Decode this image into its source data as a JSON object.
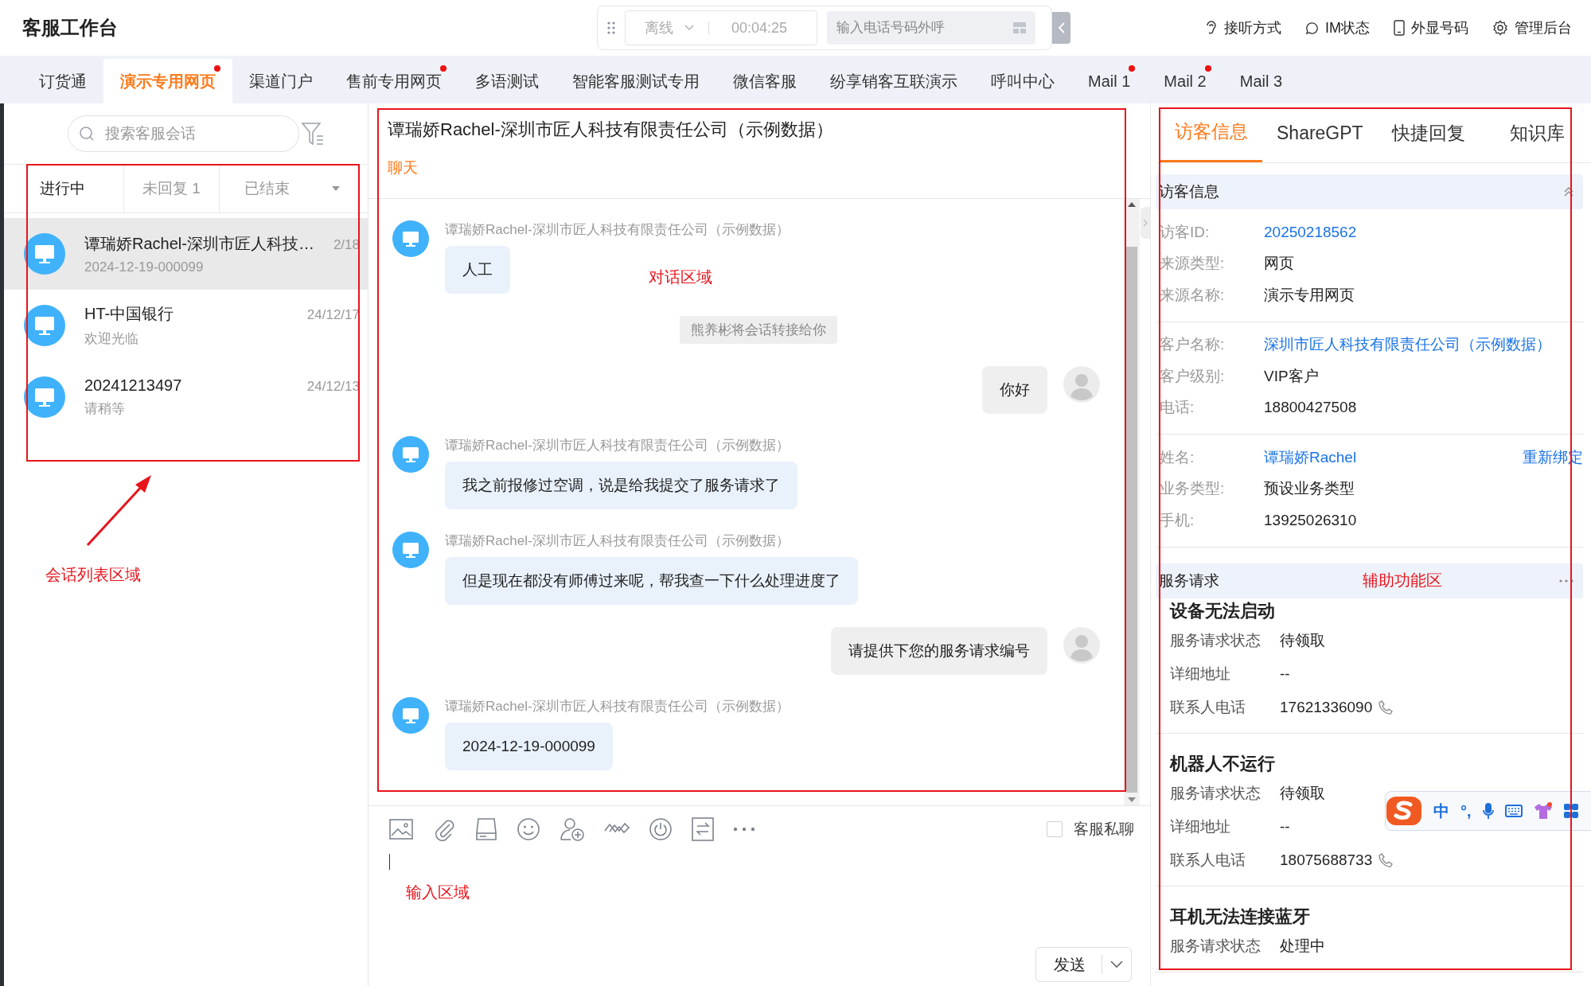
{
  "header": {
    "title": "客服工作台",
    "status": "离线",
    "timer": "00:04:25",
    "dial_placeholder": "输入电话号码外呼",
    "actions": [
      {
        "kind": "ear",
        "label": "接听方式"
      },
      {
        "kind": "chat",
        "label": "IM状态"
      },
      {
        "kind": "phone",
        "label": "外显号码"
      },
      {
        "kind": "gear",
        "label": "管理后台"
      }
    ]
  },
  "tabs": [
    {
      "label": "订货通",
      "selected": false,
      "unread": false
    },
    {
      "label": "演示专用网页",
      "selected": true,
      "unread": true
    },
    {
      "label": "渠道门户",
      "selected": false,
      "unread": false
    },
    {
      "label": "售前专用网页",
      "selected": false,
      "unread": true
    },
    {
      "label": "多语测试",
      "selected": false,
      "unread": false
    },
    {
      "label": "智能客服测试专用",
      "selected": false,
      "unread": false
    },
    {
      "label": "微信客服",
      "selected": false,
      "unread": false
    },
    {
      "label": "纷享销客互联演示",
      "selected": false,
      "unread": false
    },
    {
      "label": "呼叫中心",
      "selected": false,
      "unread": false
    },
    {
      "label": "Mail 1",
      "selected": false,
      "unread": true
    },
    {
      "label": "Mail 2",
      "selected": false,
      "unread": true
    },
    {
      "label": "Mail 3",
      "selected": false,
      "unread": false
    }
  ],
  "sessions": {
    "search_placeholder": "搜索客服会话",
    "filters": [
      {
        "label": "进行中",
        "selected": true
      },
      {
        "label": "未回复 1",
        "selected": false
      },
      {
        "label": "已结束",
        "selected": false
      }
    ],
    "items": [
      {
        "name": "谭瑞娇Rachel-深圳市匠人科技…",
        "time": "2/18",
        "preview": "2024-12-19-000099",
        "selected": true
      },
      {
        "name": "HT-中国银行",
        "time": "24/12/17",
        "preview": "欢迎光临",
        "selected": false
      },
      {
        "name": "20241213497",
        "time": "24/12/13",
        "preview": "请稍等",
        "selected": false
      }
    ]
  },
  "chat": {
    "title": "谭瑞娇Rachel-深圳市匠人科技有限责任公司（示例数据）",
    "tab": "聊天",
    "messages": [
      {
        "kind": "incoming",
        "sender": "谭瑞娇Rachel-深圳市匠人科技有限责任公司（示例数据）",
        "text": "人工"
      },
      {
        "kind": "system",
        "text": "熊养彬将会话转接给你"
      },
      {
        "kind": "outgoing",
        "text": "你好"
      },
      {
        "kind": "incoming",
        "sender": "谭瑞娇Rachel-深圳市匠人科技有限责任公司（示例数据）",
        "text": "我之前报修过空调，说是给我提交了服务请求了"
      },
      {
        "kind": "incoming",
        "sender": "谭瑞娇Rachel-深圳市匠人科技有限责任公司（示例数据）",
        "text": "但是现在都没有师傅过来呢，帮我查一下什么处理进度了"
      },
      {
        "kind": "outgoing",
        "text": "请提供下您的服务请求编号"
      },
      {
        "kind": "incoming",
        "sender": "谭瑞娇Rachel-深圳市匠人科技有限责任公司（示例数据）",
        "text": "2024-12-19-000099"
      }
    ],
    "private_chat": {
      "label": "客服私聊",
      "checked": false
    },
    "send": "发送"
  },
  "side": {
    "tabs": [
      {
        "label": "访客信息",
        "selected": true
      },
      {
        "label": "ShareGPT",
        "selected": false
      },
      {
        "label": "快捷回复",
        "selected": false
      },
      {
        "label": "知识库",
        "selected": false
      }
    ],
    "visitor": {
      "title": "访客信息",
      "groups": [
        [
          {
            "label": "访客ID:",
            "value": "20250218562",
            "link": true
          },
          {
            "label": "来源类型:",
            "value": "网页",
            "link": false
          },
          {
            "label": "来源名称:",
            "value": "演示专用网页",
            "link": false
          }
        ],
        [
          {
            "label": "客户名称:",
            "value": "深圳市匠人科技有限责任公司（示例数据）",
            "link": true
          },
          {
            "label": "客户级别:",
            "value": "VIP客户",
            "link": false
          },
          {
            "label": "电话:",
            "value": "18800427508",
            "link": false
          }
        ],
        [
          {
            "label": "姓名:",
            "value": "谭瑞娇Rachel",
            "link": true,
            "action": "重新绑定"
          },
          {
            "label": "业务类型:",
            "value": "预设业务类型",
            "link": false
          },
          {
            "label": "手机:",
            "value": "13925026310",
            "link": false
          }
        ]
      ]
    },
    "service": {
      "title": "服务请求",
      "requests": [
        {
          "title": "设备无法启动",
          "fields": [
            {
              "label": "服务请求状态",
              "value": "待领取",
              "phone": false
            },
            {
              "label": "详细地址",
              "value": "--",
              "phone": false
            },
            {
              "label": "联系人电话",
              "value": "17621336090",
              "phone": true
            }
          ]
        },
        {
          "title": "机器人不运行",
          "fields": [
            {
              "label": "服务请求状态",
              "value": "待领取",
              "phone": false
            },
            {
              "label": "详细地址",
              "value": "--",
              "phone": false
            },
            {
              "label": "联系人电话",
              "value": "18075688733",
              "phone": true
            }
          ]
        },
        {
          "title": "耳机无法连接蓝牙",
          "fields": [
            {
              "label": "服务请求状态",
              "value": "处理中",
              "phone": false
            }
          ]
        }
      ]
    }
  },
  "ime": {
    "mode": "中",
    "punct": "°,"
  },
  "annotations": [
    {
      "text": "会话列表区域"
    },
    {
      "text": "对话区域"
    },
    {
      "text": "输入区域"
    },
    {
      "text": "辅助功能区"
    }
  ]
}
